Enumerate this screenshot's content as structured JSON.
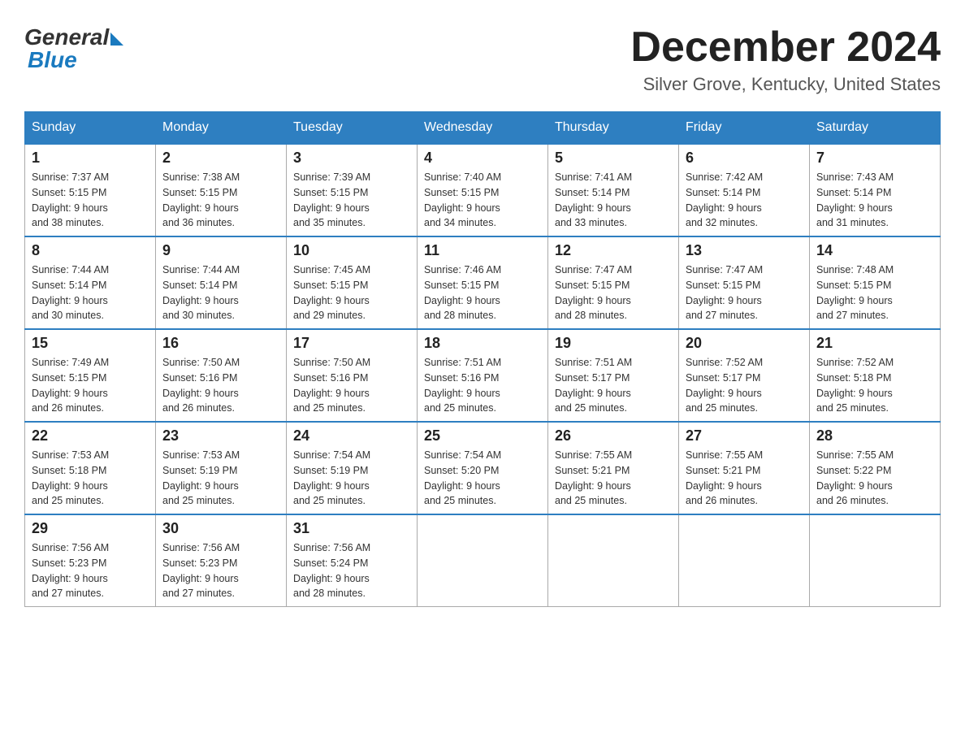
{
  "header": {
    "logo_general": "General",
    "logo_blue": "Blue",
    "month_title": "December 2024",
    "location": "Silver Grove, Kentucky, United States"
  },
  "days_of_week": [
    "Sunday",
    "Monday",
    "Tuesday",
    "Wednesday",
    "Thursday",
    "Friday",
    "Saturday"
  ],
  "weeks": [
    [
      {
        "day": "1",
        "sunrise": "7:37 AM",
        "sunset": "5:15 PM",
        "daylight": "9 hours and 38 minutes."
      },
      {
        "day": "2",
        "sunrise": "7:38 AM",
        "sunset": "5:15 PM",
        "daylight": "9 hours and 36 minutes."
      },
      {
        "day": "3",
        "sunrise": "7:39 AM",
        "sunset": "5:15 PM",
        "daylight": "9 hours and 35 minutes."
      },
      {
        "day": "4",
        "sunrise": "7:40 AM",
        "sunset": "5:15 PM",
        "daylight": "9 hours and 34 minutes."
      },
      {
        "day": "5",
        "sunrise": "7:41 AM",
        "sunset": "5:14 PM",
        "daylight": "9 hours and 33 minutes."
      },
      {
        "day": "6",
        "sunrise": "7:42 AM",
        "sunset": "5:14 PM",
        "daylight": "9 hours and 32 minutes."
      },
      {
        "day": "7",
        "sunrise": "7:43 AM",
        "sunset": "5:14 PM",
        "daylight": "9 hours and 31 minutes."
      }
    ],
    [
      {
        "day": "8",
        "sunrise": "7:44 AM",
        "sunset": "5:14 PM",
        "daylight": "9 hours and 30 minutes."
      },
      {
        "day": "9",
        "sunrise": "7:44 AM",
        "sunset": "5:14 PM",
        "daylight": "9 hours and 30 minutes."
      },
      {
        "day": "10",
        "sunrise": "7:45 AM",
        "sunset": "5:15 PM",
        "daylight": "9 hours and 29 minutes."
      },
      {
        "day": "11",
        "sunrise": "7:46 AM",
        "sunset": "5:15 PM",
        "daylight": "9 hours and 28 minutes."
      },
      {
        "day": "12",
        "sunrise": "7:47 AM",
        "sunset": "5:15 PM",
        "daylight": "9 hours and 28 minutes."
      },
      {
        "day": "13",
        "sunrise": "7:47 AM",
        "sunset": "5:15 PM",
        "daylight": "9 hours and 27 minutes."
      },
      {
        "day": "14",
        "sunrise": "7:48 AM",
        "sunset": "5:15 PM",
        "daylight": "9 hours and 27 minutes."
      }
    ],
    [
      {
        "day": "15",
        "sunrise": "7:49 AM",
        "sunset": "5:15 PM",
        "daylight": "9 hours and 26 minutes."
      },
      {
        "day": "16",
        "sunrise": "7:50 AM",
        "sunset": "5:16 PM",
        "daylight": "9 hours and 26 minutes."
      },
      {
        "day": "17",
        "sunrise": "7:50 AM",
        "sunset": "5:16 PM",
        "daylight": "9 hours and 25 minutes."
      },
      {
        "day": "18",
        "sunrise": "7:51 AM",
        "sunset": "5:16 PM",
        "daylight": "9 hours and 25 minutes."
      },
      {
        "day": "19",
        "sunrise": "7:51 AM",
        "sunset": "5:17 PM",
        "daylight": "9 hours and 25 minutes."
      },
      {
        "day": "20",
        "sunrise": "7:52 AM",
        "sunset": "5:17 PM",
        "daylight": "9 hours and 25 minutes."
      },
      {
        "day": "21",
        "sunrise": "7:52 AM",
        "sunset": "5:18 PM",
        "daylight": "9 hours and 25 minutes."
      }
    ],
    [
      {
        "day": "22",
        "sunrise": "7:53 AM",
        "sunset": "5:18 PM",
        "daylight": "9 hours and 25 minutes."
      },
      {
        "day": "23",
        "sunrise": "7:53 AM",
        "sunset": "5:19 PM",
        "daylight": "9 hours and 25 minutes."
      },
      {
        "day": "24",
        "sunrise": "7:54 AM",
        "sunset": "5:19 PM",
        "daylight": "9 hours and 25 minutes."
      },
      {
        "day": "25",
        "sunrise": "7:54 AM",
        "sunset": "5:20 PM",
        "daylight": "9 hours and 25 minutes."
      },
      {
        "day": "26",
        "sunrise": "7:55 AM",
        "sunset": "5:21 PM",
        "daylight": "9 hours and 25 minutes."
      },
      {
        "day": "27",
        "sunrise": "7:55 AM",
        "sunset": "5:21 PM",
        "daylight": "9 hours and 26 minutes."
      },
      {
        "day": "28",
        "sunrise": "7:55 AM",
        "sunset": "5:22 PM",
        "daylight": "9 hours and 26 minutes."
      }
    ],
    [
      {
        "day": "29",
        "sunrise": "7:56 AM",
        "sunset": "5:23 PM",
        "daylight": "9 hours and 27 minutes."
      },
      {
        "day": "30",
        "sunrise": "7:56 AM",
        "sunset": "5:23 PM",
        "daylight": "9 hours and 27 minutes."
      },
      {
        "day": "31",
        "sunrise": "7:56 AM",
        "sunset": "5:24 PM",
        "daylight": "9 hours and 28 minutes."
      },
      null,
      null,
      null,
      null
    ]
  ],
  "labels": {
    "sunrise": "Sunrise:",
    "sunset": "Sunset:",
    "daylight": "Daylight:"
  }
}
